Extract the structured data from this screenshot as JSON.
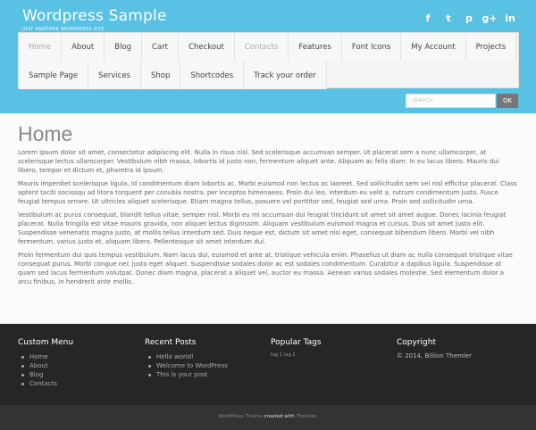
{
  "site": {
    "title": "Wordpress Sample",
    "tagline": "JUST ANOTHER WORDPRESS SITE",
    "accent_color": "#59c1e4"
  },
  "social_icons": [
    {
      "name": "facebook-icon",
      "glyph": "f"
    },
    {
      "name": "twitter-icon",
      "glyph": "t"
    },
    {
      "name": "pinterest-icon",
      "glyph": "p"
    },
    {
      "name": "google-plus-icon",
      "glyph": "g+"
    },
    {
      "name": "linkedin-icon",
      "glyph": "in"
    }
  ],
  "nav": {
    "row1": [
      "Home",
      "About",
      "Blog",
      "Cart",
      "Checkout",
      "Contacts",
      "Features",
      "Font Icons",
      "My Account",
      "Projects"
    ],
    "row2": [
      "Sample Page",
      "Services",
      "Shop",
      "Shortcodes",
      "Track your order"
    ]
  },
  "search": {
    "placeholder": "SEARCH",
    "button": "OK"
  },
  "page": {
    "title": "Home",
    "paragraphs": [
      "Lorem ipsum dolor sit amet, consectetur adipiscing elit. Nulla in risus nisl. Sed scelerisque accumsan semper. Ut placerat sem a nunc ullamcorper, at scelerisque lectus ullamcorper. Vestibulum nibh massa, lobortis id justo non, fermentum aliquet ante. Aliquam ac felis diam. In eu lacus libero. Mauris dui libero, tempor et dictum et, pharetra id ipsum.",
      "Mauris imperdiet scelerisque ligula, id condimentum diam lobortis ac. Morbi euismod non lectus ac laoreet. Sed sollicitudin sem vel nisl efficitur placerat. Class aptent taciti sociosqu ad litora torquent per conubia nostra, per inceptos himenaeos. Proin dui leo, interdum eu velit a, rutrum condimentum justo. Fusce feugiat tempus ornare. Ut ultricies aliquet scelerisque. Etiam magna tellus, posuere vel porttitor sed, feugiat sed urna. Proin sed sollicitudin urna.",
      "Vestibulum ac purus consequat, blandit tellus vitae, semper nisl. Morbi eu mi accumsan dui feugiat tincidunt sit amet sit amet augue. Donec lacinia feugiat placerat. Nulla fringilla est vitae mauris gravida, non aliquet lectus dignissim. Aliquam vestibulum euismod magna et cursus. Duis sit amet justo elit. Suspendisse venenatis magna justo, at mollis tellus interdum sed. Duis neque est, dictum sit amet nisl eget, consequat bibendum libero. Morbi vel nibh fermentum, varius justo et, aliquam libero. Pellentesque sit amet interdum dui.",
      "Proin fermentum dui quis tempus vestibulum. Nam lacus dui, euismod et ante at, tristique vehicula enim. Phasellus ut diam ac nulla consequat tristique vitae consequat purus. Morbi congue nec justo eget aliquet. Suspendisse sodales dolor ac est sodales condimentum. Curabitur a dapibus ligula. Suspendisse at quam sed lacus fermentum volutpat. Donec diam magna, placerat a aliquet vel, auctor eu massa. Aenean varius sodales molestie. Sed elementum dolor a arcu finibus, in hendrerit ante mollis."
    ]
  },
  "footer": {
    "custom_menu": {
      "title": "Custom Menu",
      "items": [
        "Home",
        "About",
        "Blog",
        "Contacts"
      ]
    },
    "recent_posts": {
      "title": "Recent Posts",
      "items": [
        "Hello world!",
        "Welcome to WordPress",
        "This is your post"
      ]
    },
    "popular_tags": {
      "title": "Popular Tags",
      "tags": "tag 1 tag 2"
    },
    "copyright": {
      "title": "Copyright",
      "text": "© 2014, Billion Themler"
    }
  },
  "bottom_bar": {
    "part1": "WordPress Theme",
    "part2": "created with",
    "part3": "Themler",
    "part4": "."
  }
}
